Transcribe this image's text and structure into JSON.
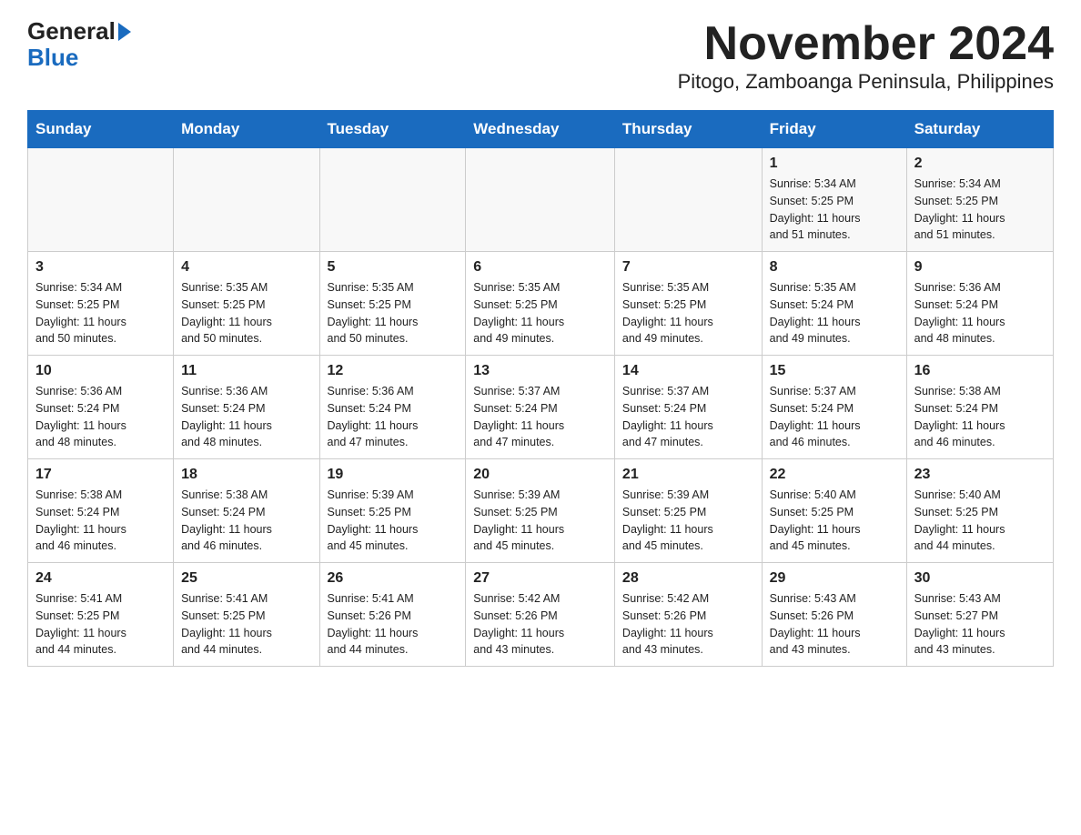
{
  "logo": {
    "general": "General",
    "blue": "Blue"
  },
  "title": "November 2024",
  "subtitle": "Pitogo, Zamboanga Peninsula, Philippines",
  "days_of_week": [
    "Sunday",
    "Monday",
    "Tuesday",
    "Wednesday",
    "Thursday",
    "Friday",
    "Saturday"
  ],
  "weeks": [
    [
      {
        "day": "",
        "info": ""
      },
      {
        "day": "",
        "info": ""
      },
      {
        "day": "",
        "info": ""
      },
      {
        "day": "",
        "info": ""
      },
      {
        "day": "",
        "info": ""
      },
      {
        "day": "1",
        "info": "Sunrise: 5:34 AM\nSunset: 5:25 PM\nDaylight: 11 hours\nand 51 minutes."
      },
      {
        "day": "2",
        "info": "Sunrise: 5:34 AM\nSunset: 5:25 PM\nDaylight: 11 hours\nand 51 minutes."
      }
    ],
    [
      {
        "day": "3",
        "info": "Sunrise: 5:34 AM\nSunset: 5:25 PM\nDaylight: 11 hours\nand 50 minutes."
      },
      {
        "day": "4",
        "info": "Sunrise: 5:35 AM\nSunset: 5:25 PM\nDaylight: 11 hours\nand 50 minutes."
      },
      {
        "day": "5",
        "info": "Sunrise: 5:35 AM\nSunset: 5:25 PM\nDaylight: 11 hours\nand 50 minutes."
      },
      {
        "day": "6",
        "info": "Sunrise: 5:35 AM\nSunset: 5:25 PM\nDaylight: 11 hours\nand 49 minutes."
      },
      {
        "day": "7",
        "info": "Sunrise: 5:35 AM\nSunset: 5:25 PM\nDaylight: 11 hours\nand 49 minutes."
      },
      {
        "day": "8",
        "info": "Sunrise: 5:35 AM\nSunset: 5:24 PM\nDaylight: 11 hours\nand 49 minutes."
      },
      {
        "day": "9",
        "info": "Sunrise: 5:36 AM\nSunset: 5:24 PM\nDaylight: 11 hours\nand 48 minutes."
      }
    ],
    [
      {
        "day": "10",
        "info": "Sunrise: 5:36 AM\nSunset: 5:24 PM\nDaylight: 11 hours\nand 48 minutes."
      },
      {
        "day": "11",
        "info": "Sunrise: 5:36 AM\nSunset: 5:24 PM\nDaylight: 11 hours\nand 48 minutes."
      },
      {
        "day": "12",
        "info": "Sunrise: 5:36 AM\nSunset: 5:24 PM\nDaylight: 11 hours\nand 47 minutes."
      },
      {
        "day": "13",
        "info": "Sunrise: 5:37 AM\nSunset: 5:24 PM\nDaylight: 11 hours\nand 47 minutes."
      },
      {
        "day": "14",
        "info": "Sunrise: 5:37 AM\nSunset: 5:24 PM\nDaylight: 11 hours\nand 47 minutes."
      },
      {
        "day": "15",
        "info": "Sunrise: 5:37 AM\nSunset: 5:24 PM\nDaylight: 11 hours\nand 46 minutes."
      },
      {
        "day": "16",
        "info": "Sunrise: 5:38 AM\nSunset: 5:24 PM\nDaylight: 11 hours\nand 46 minutes."
      }
    ],
    [
      {
        "day": "17",
        "info": "Sunrise: 5:38 AM\nSunset: 5:24 PM\nDaylight: 11 hours\nand 46 minutes."
      },
      {
        "day": "18",
        "info": "Sunrise: 5:38 AM\nSunset: 5:24 PM\nDaylight: 11 hours\nand 46 minutes."
      },
      {
        "day": "19",
        "info": "Sunrise: 5:39 AM\nSunset: 5:25 PM\nDaylight: 11 hours\nand 45 minutes."
      },
      {
        "day": "20",
        "info": "Sunrise: 5:39 AM\nSunset: 5:25 PM\nDaylight: 11 hours\nand 45 minutes."
      },
      {
        "day": "21",
        "info": "Sunrise: 5:39 AM\nSunset: 5:25 PM\nDaylight: 11 hours\nand 45 minutes."
      },
      {
        "day": "22",
        "info": "Sunrise: 5:40 AM\nSunset: 5:25 PM\nDaylight: 11 hours\nand 45 minutes."
      },
      {
        "day": "23",
        "info": "Sunrise: 5:40 AM\nSunset: 5:25 PM\nDaylight: 11 hours\nand 44 minutes."
      }
    ],
    [
      {
        "day": "24",
        "info": "Sunrise: 5:41 AM\nSunset: 5:25 PM\nDaylight: 11 hours\nand 44 minutes."
      },
      {
        "day": "25",
        "info": "Sunrise: 5:41 AM\nSunset: 5:25 PM\nDaylight: 11 hours\nand 44 minutes."
      },
      {
        "day": "26",
        "info": "Sunrise: 5:41 AM\nSunset: 5:26 PM\nDaylight: 11 hours\nand 44 minutes."
      },
      {
        "day": "27",
        "info": "Sunrise: 5:42 AM\nSunset: 5:26 PM\nDaylight: 11 hours\nand 43 minutes."
      },
      {
        "day": "28",
        "info": "Sunrise: 5:42 AM\nSunset: 5:26 PM\nDaylight: 11 hours\nand 43 minutes."
      },
      {
        "day": "29",
        "info": "Sunrise: 5:43 AM\nSunset: 5:26 PM\nDaylight: 11 hours\nand 43 minutes."
      },
      {
        "day": "30",
        "info": "Sunrise: 5:43 AM\nSunset: 5:27 PM\nDaylight: 11 hours\nand 43 minutes."
      }
    ]
  ]
}
